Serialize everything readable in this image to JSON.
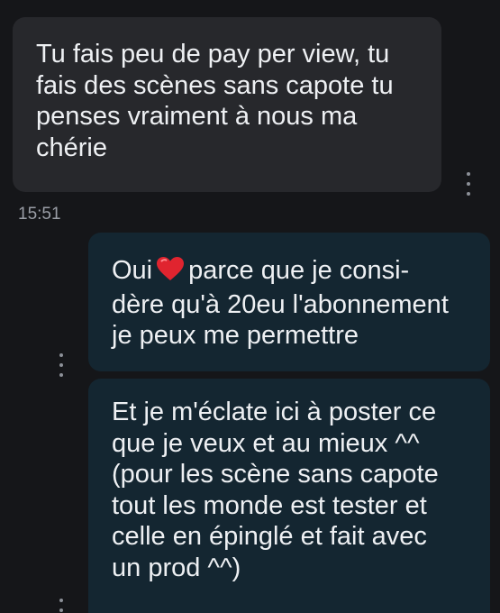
{
  "messages": {
    "incoming": {
      "text": "Tu fais peu de pay per view, tu\nfais des scènes sans capote tu\npenses vraiment à nous ma\nchérie",
      "time": "15:51"
    },
    "outgoing_1": {
      "before_heart": "Oui",
      "after_heart": "parce que je consi-\ndère qu'à 20eu l'abonnement\nje peux me permettre",
      "heart_emoji": "red-heart-icon"
    },
    "outgoing_2": {
      "text": "Et je m'éclate ici à poster ce\nque je veux et au mieux ^^\n(pour les scène sans capote\ntout les monde est tester et\ncelle en épinglé et fait avec\nun prod ^^)"
    }
  },
  "colors": {
    "background": "#151619",
    "incoming_bubble": "#27282c",
    "outgoing_bubble": "#142631",
    "text": "#eef0f3",
    "timestamp": "#9a9ea6",
    "heart": "#e0242f"
  },
  "icons": {
    "message_options": "more-vertical-icon"
  }
}
